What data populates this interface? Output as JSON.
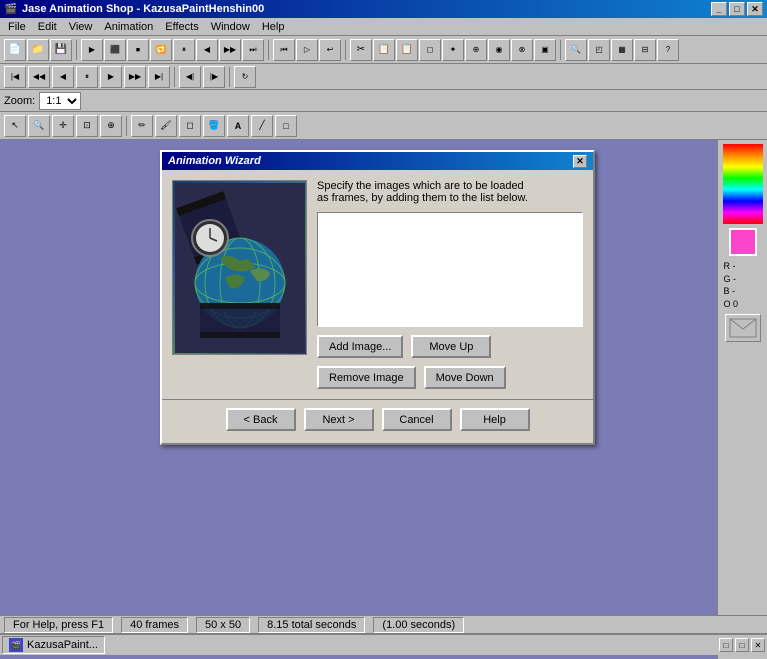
{
  "app": {
    "title": "Jase Animation Shop - KazusaPaintHenshin00",
    "icon": "🎬"
  },
  "title_controls": {
    "minimize": "_",
    "maximize": "□",
    "close": "✕"
  },
  "menu": {
    "items": [
      "File",
      "Edit",
      "View",
      "Animation",
      "Effects",
      "Window",
      "Help"
    ]
  },
  "zoom": {
    "label": "Zoom:",
    "value": "1:1"
  },
  "dialog": {
    "title": "Animation Wizard",
    "instruction_line1": "Specify the images which are to be loaded",
    "instruction_line2": "as frames, by adding them to the list below.",
    "buttons": {
      "add_image": "Add Image...",
      "remove_image": "Remove Image",
      "move_up": "Move Up",
      "move_down": "Move Down"
    },
    "footer": {
      "back": "< Back",
      "next": "Next >",
      "cancel": "Cancel",
      "help": "Help"
    }
  },
  "right_panel": {
    "rgb_labels": [
      "R -",
      "G -",
      "B -",
      "O 0"
    ]
  },
  "status_bar": {
    "help_text": "For Help, press F1",
    "frames": "40 frames",
    "size": "50 x 50",
    "duration": "8.15 total seconds",
    "rate": "(1.00 seconds)"
  },
  "taskbar": {
    "item": "KazusaPaint...",
    "controls": [
      "□",
      "□",
      "✕"
    ]
  }
}
